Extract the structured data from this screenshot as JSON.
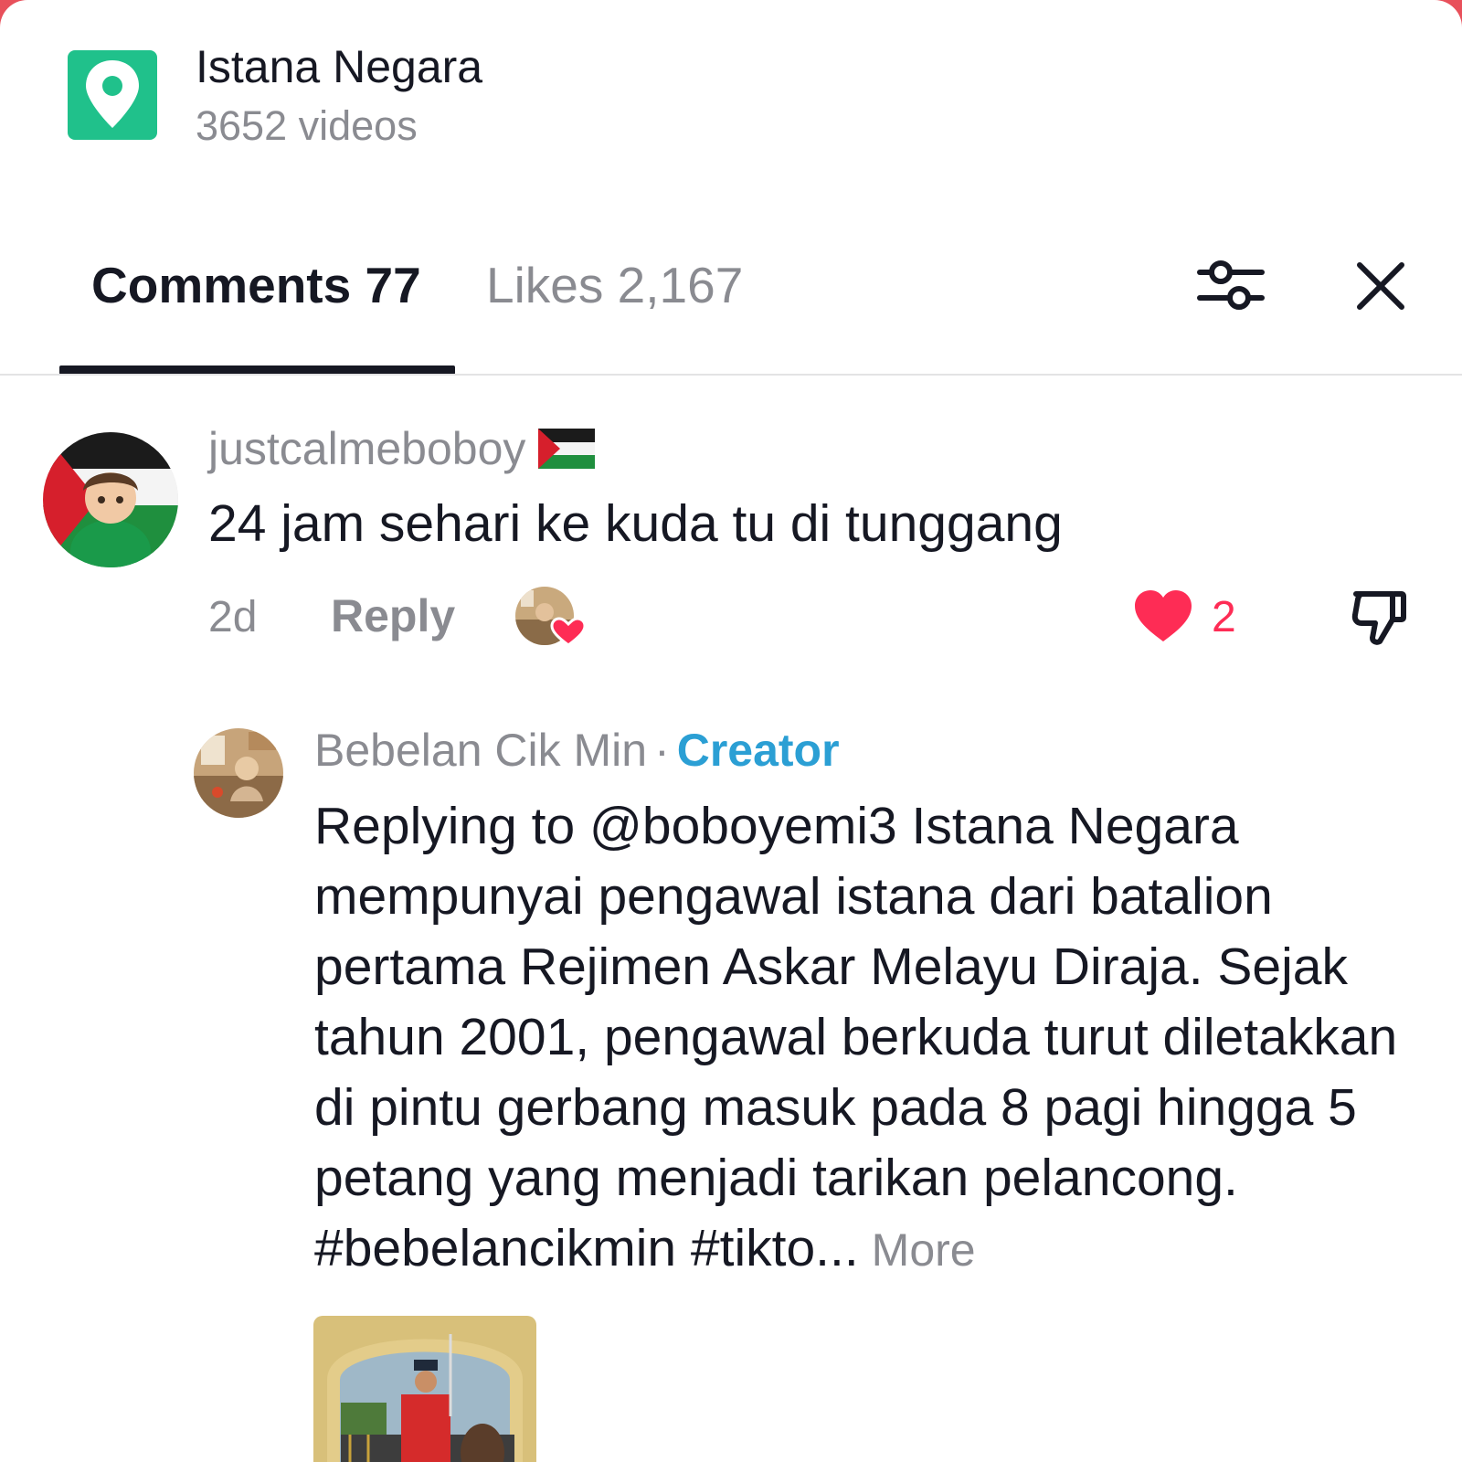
{
  "location": {
    "icon": "location-pin-icon",
    "title": "Istana Negara",
    "subtitle": "3652 videos",
    "badge_color": "#20c18b"
  },
  "tabs": {
    "comments_label": "Comments 77",
    "likes_label": "Likes 2,167",
    "active": "comments"
  },
  "toolbar": {
    "filter_icon": "filter-sliders-icon",
    "close_icon": "close-icon"
  },
  "comment": {
    "username": "justcalmeboboy",
    "flag_icon": "palestine-flag-icon",
    "text": "24 jam sehari ke kuda tu di tunggang",
    "time": "2d",
    "reply_label": "Reply",
    "like_count": "2",
    "liked_by_creator": true,
    "like_color": "#fe2c55"
  },
  "reply": {
    "username": "Bebelan Cik Min",
    "separator": "·",
    "creator_label": "Creator",
    "creator_color": "#2b9fd4",
    "text": "Replying to @boboyemi3  Istana Negara mempunyai pengawal istana dari batalion pertama Rejimen Askar Melayu Diraja. Sejak tahun 2001, pengawal berkuda turut diletakkan di pintu gerbang masuk pada 8 pagi hingga 5 petang yang menjadi tarikan pelancong. #bebelancikmin #tikto...",
    "more_label": "More"
  }
}
